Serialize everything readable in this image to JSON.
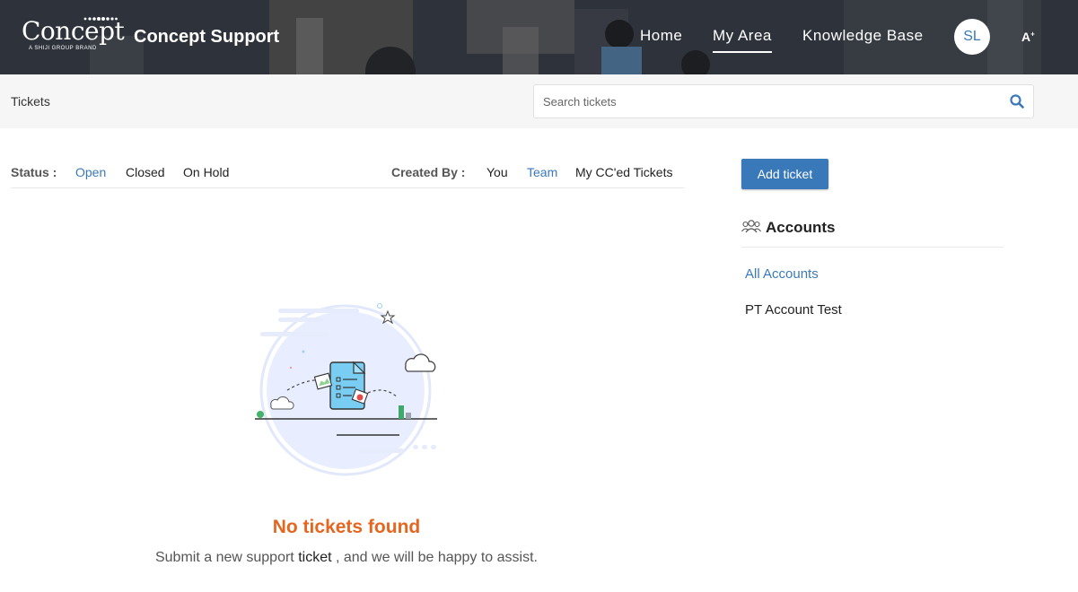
{
  "header": {
    "logo_text": "Concept",
    "logo_subtext": "A SHIJI GROUP BRAND",
    "site_title": "Concept Support",
    "nav": [
      {
        "label": "Home",
        "active": false
      },
      {
        "label": "My Area",
        "active": true
      },
      {
        "label": "Knowledge Base",
        "active": false
      }
    ],
    "avatar_initials": "SL",
    "font_size_label": "A",
    "font_size_sup": "+"
  },
  "subbar": {
    "breadcrumb": "Tickets",
    "search_placeholder": "Search tickets",
    "search_value": "",
    "search_icon": "search-icon"
  },
  "filters": {
    "status_label": "Status :",
    "status_options": [
      {
        "label": "Open",
        "selected": true
      },
      {
        "label": "Closed",
        "selected": false
      },
      {
        "label": "On Hold",
        "selected": false
      }
    ],
    "created_by_label": "Created By :",
    "created_by_options": [
      {
        "label": "You",
        "selected": false
      },
      {
        "label": "Team",
        "selected": true
      },
      {
        "label": "My CC'ed Tickets",
        "selected": false
      }
    ]
  },
  "empty_state": {
    "illustration": "empty-tickets-illustration",
    "title": "No tickets found",
    "message_before": "Submit a new support",
    "message_link": "ticket",
    "message_after": ", and we will be happy to assist."
  },
  "sidebar": {
    "add_ticket_label": "Add ticket",
    "accounts_title": "Accounts",
    "accounts_icon": "users-icon",
    "accounts": [
      "All Accounts",
      "PT Account Test"
    ]
  },
  "colors": {
    "accent": "#3a79b9",
    "empty_title": "#e4661f",
    "subbar_bg": "#f6f6f6"
  }
}
